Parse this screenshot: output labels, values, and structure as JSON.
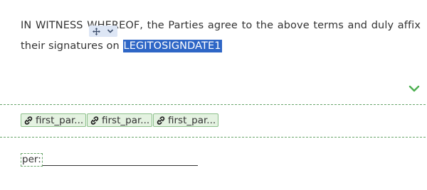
{
  "document": {
    "paragraph_before": "IN WITNESS WHEREOF, the Parties agree to the above terms and duly affix their signatures on ",
    "selected_placeholder": "LEGITOSIGNDATE1"
  },
  "field_toolbar": {
    "icons": [
      "move-icon",
      "chevron-down-icon"
    ]
  },
  "section_toggle": {
    "icon": "chevron-down-icon",
    "color": "#4caf50"
  },
  "signature_fields": [
    {
      "label": "first_par..."
    },
    {
      "label": "first_par..."
    },
    {
      "label": "first_par..."
    }
  ],
  "signature_line": {
    "label": "per:"
  },
  "colors": {
    "selection": "#2e66c6",
    "field_green_bg": "#e4f2e1",
    "field_green_border": "#8cc08a",
    "dashed_divider": "#6aa66c"
  }
}
